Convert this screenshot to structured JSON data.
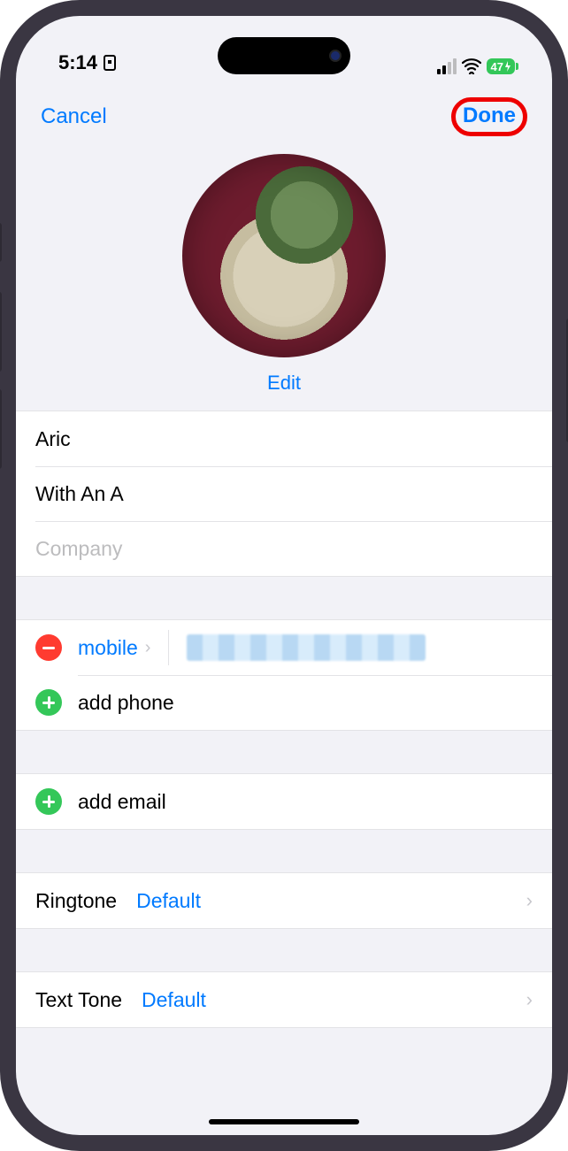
{
  "status": {
    "time": "5:14",
    "battery": "47"
  },
  "nav": {
    "cancel": "Cancel",
    "done": "Done"
  },
  "avatar": {
    "edit_label": "Edit"
  },
  "name_fields": {
    "first": "Aric",
    "last": "With An A",
    "company_placeholder": "Company"
  },
  "phones": {
    "entry": {
      "type_label": "mobile"
    },
    "add_label": "add phone"
  },
  "emails": {
    "add_label": "add email"
  },
  "ringtone": {
    "label": "Ringtone",
    "value": "Default"
  },
  "texttone": {
    "label": "Text Tone",
    "value": "Default"
  }
}
